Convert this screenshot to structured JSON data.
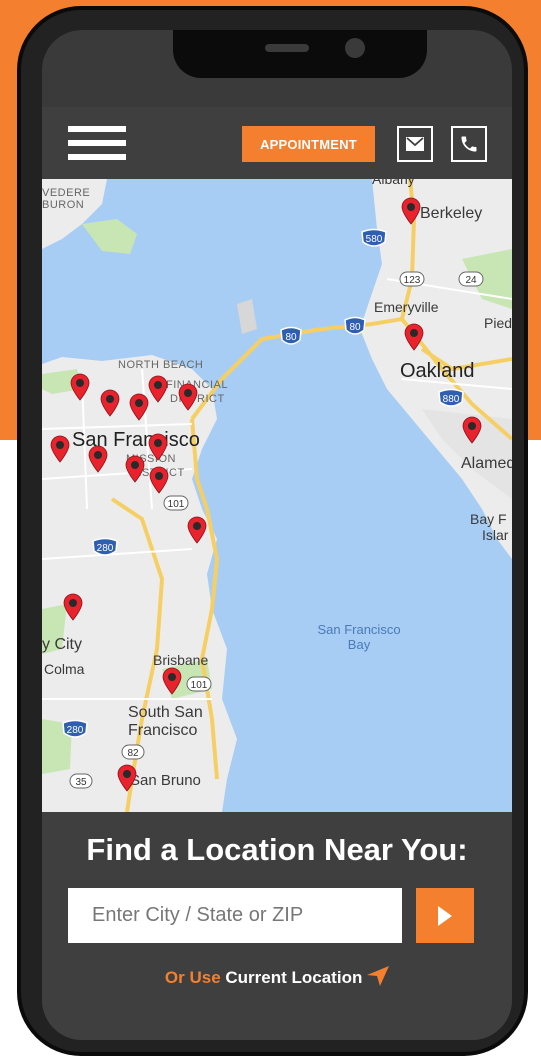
{
  "header": {
    "appointment_label": "APPOINTMENT",
    "menu_icon": "hamburger-menu-icon",
    "email_icon": "envelope-icon",
    "phone_icon": "phone-icon"
  },
  "map": {
    "labels": {
      "berkeley": "Berkeley",
      "emeryville": "Emeryville",
      "oakland": "Oakland",
      "alameda": "Alamed",
      "piedmont": "Pied",
      "bay_farm": "Bay F",
      "bay_farm2": "Islar",
      "north_beach": "NORTH BEACH",
      "financial": "FINANCIAL",
      "district": "DISTRICT",
      "san_francisco": "San Francisco",
      "mission": "MISSION",
      "mission2": "DISTRICT",
      "belvedere": "VEDERE",
      "buron": "BURON",
      "sf_bay": "San Francisco",
      "sf_bay2": "Bay",
      "daly_city": "y City",
      "colma": "Colma",
      "brisbane": "Brisbane",
      "south_sf": "South San",
      "south_sf2": "Francisco",
      "san_bruno": "San Bruno",
      "albany": "Albany"
    },
    "shields": {
      "i580": "580",
      "i80a": "80",
      "i80b": "80",
      "i880": "880",
      "r123": "123",
      "r24": "24",
      "us101a": "101",
      "us101b": "101",
      "i280a": "280",
      "i280b": "280",
      "r82": "82",
      "r35": "35"
    },
    "pin_icon": "map-pin-icon",
    "pin_color": "#e8232d"
  },
  "finder": {
    "title": "Find a Location Near You:",
    "placeholder": "Enter City / State or ZIP",
    "go_icon": "play-arrow-icon",
    "or_use": "Or Use",
    "current_location": "Current Location",
    "location_icon": "location-arrow-icon"
  },
  "colors": {
    "accent": "#f47f2e",
    "dark": "#3f3f3f",
    "water": "#a8cdf4",
    "land": "#ececec",
    "park": "#c8e6b4"
  }
}
